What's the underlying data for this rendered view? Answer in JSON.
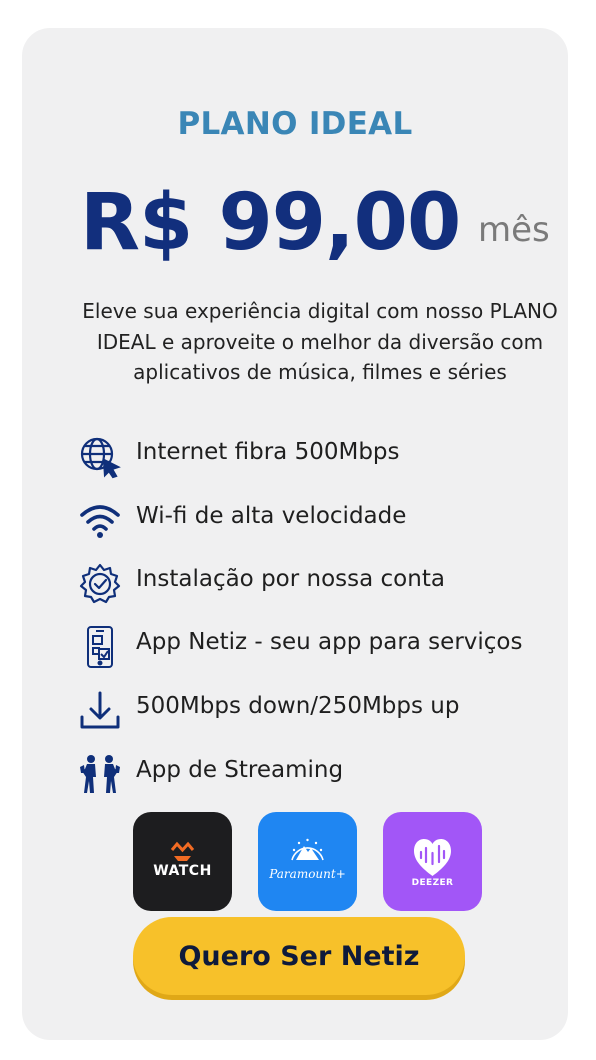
{
  "plan": {
    "title": "PLANO IDEAL",
    "price": "R$ 99,00",
    "period": "mês",
    "description": "Eleve sua experiência digital com nosso PLANO IDEAL e aproveite o melhor da diversão com aplicativos de música, filmes e séries"
  },
  "features": [
    {
      "icon": "globe-cursor-icon",
      "label": "Internet fibra 500Mbps"
    },
    {
      "icon": "wifi-icon",
      "label": "Wi-fi de alta velocidade"
    },
    {
      "icon": "gear-check-icon",
      "label": "Instalação por nossa conta"
    },
    {
      "icon": "phone-app-icon",
      "label": "App Netiz - seu app para serviços"
    },
    {
      "icon": "download-icon",
      "label": "500Mbps down/250Mbps up"
    },
    {
      "icon": "people-streaming-icon",
      "label": "App de Streaming"
    }
  ],
  "apps": [
    {
      "name": "WATCH",
      "bg": "#1d1d1f"
    },
    {
      "name": "Paramount+",
      "bg": "#1f86f2"
    },
    {
      "name": "DEEZER",
      "bg": "#a256f7"
    }
  ],
  "cta": {
    "label": "Quero Ser Netiz"
  },
  "colors": {
    "title": "#3a86b6",
    "price": "#122f7d",
    "icon": "#0f2f7a",
    "cta": "#f7c12a",
    "card": "#f0f0f1"
  }
}
